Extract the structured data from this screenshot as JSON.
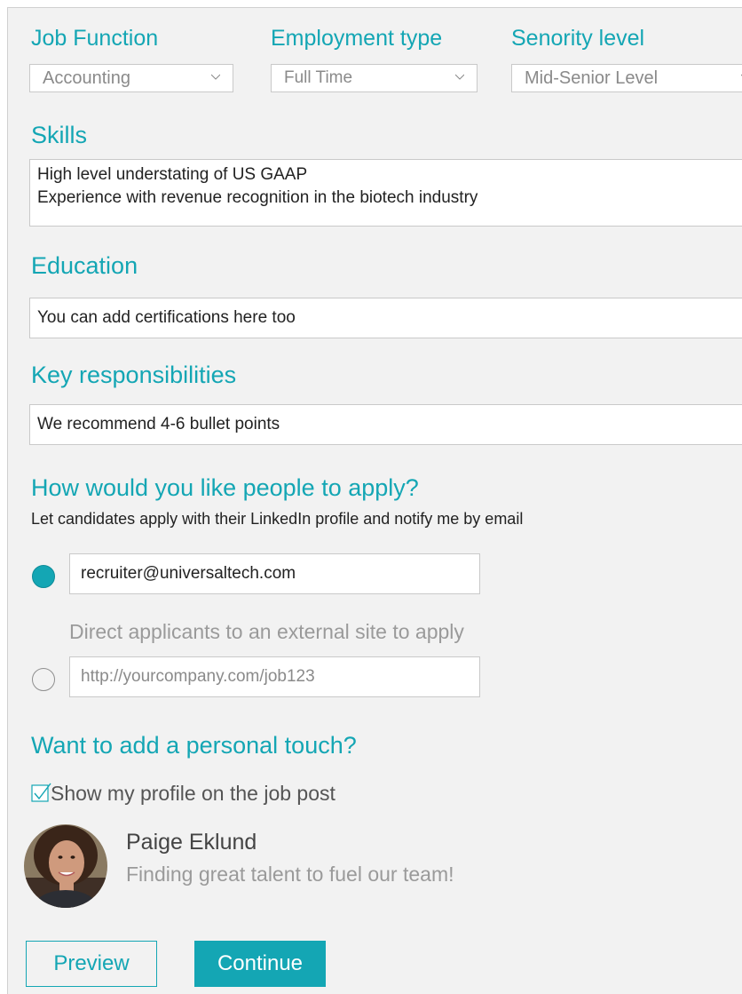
{
  "filters": {
    "job_function": {
      "label": "Job Function",
      "value": "Accounting"
    },
    "employment_type": {
      "label": "Employment type",
      "value": "Full Time"
    },
    "seniority_level": {
      "label": "Senority level",
      "value": "Mid-Senior Level"
    }
  },
  "skills": {
    "label": "Skills",
    "lines": [
      "High level understating of US GAAP",
      "Experience with revenue recognition in the biotech industry"
    ]
  },
  "education": {
    "label": "Education",
    "placeholder": "You can add certifications here too"
  },
  "responsibilities": {
    "label": "Key responsibilities",
    "placeholder": "We recommend 4-6 bullet points"
  },
  "apply": {
    "title": "How would you like people to apply?",
    "subtitle": "Let candidates apply with their LinkedIn profile and notify me by email",
    "email_value": "recruiter@universaltech.com",
    "external_label": "Direct applicants to an external site to apply",
    "external_placeholder": "http://yourcompany.com/job123"
  },
  "personal": {
    "title": "Want to add a personal touch?",
    "checkbox_label": "Show my profile on the job post",
    "checkbox_checked": true,
    "name": "Paige Eklund",
    "tagline": "Finding great talent to fuel our team!"
  },
  "buttons": {
    "preview": "Preview",
    "continue": "Continue"
  },
  "colors": {
    "accent": "#14a6b4",
    "panel_bg": "#f2f2f2"
  }
}
